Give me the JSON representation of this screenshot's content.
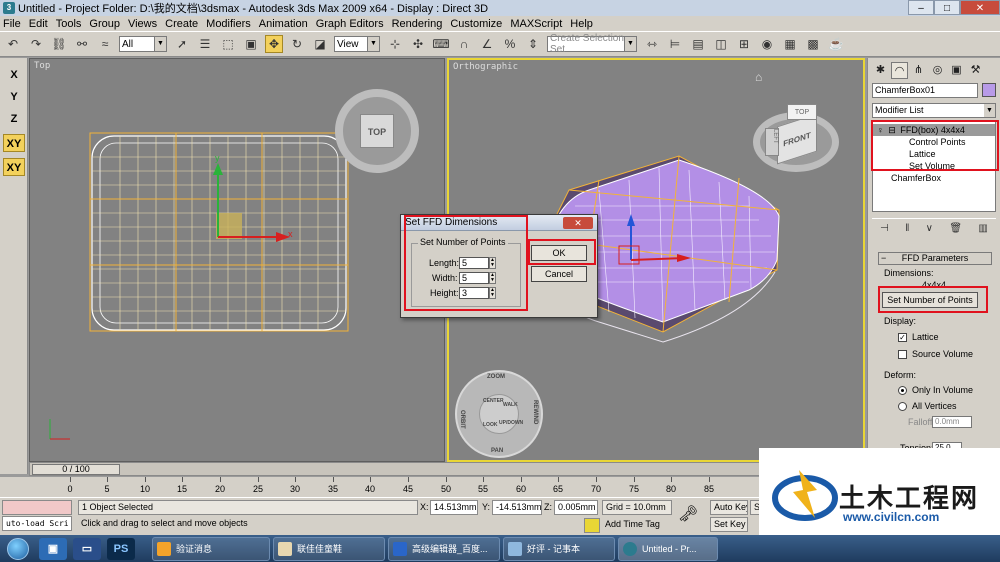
{
  "window": {
    "title": "Untitled     - Project Folder: D:\\我的文档\\3dsmax     - Autodesk 3ds Max  2009 x64     - Display : Direct 3D",
    "minimize": "–",
    "maximize": "□",
    "close": "✕"
  },
  "menu": [
    "File",
    "Edit",
    "Tools",
    "Group",
    "Views",
    "Create",
    "Modifiers",
    "Animation",
    "Graph Editors",
    "Rendering",
    "Customize",
    "MAXScript",
    "Help"
  ],
  "toolbar": {
    "filter_value": "All",
    "refcoord_value": "View",
    "selection_set_placeholder": "Create Selection Set"
  },
  "axis_constraints": [
    "X",
    "Y",
    "Z",
    "XY",
    "XY"
  ],
  "viewports": {
    "top": {
      "label": "Top",
      "viewcube_label": "TOP"
    },
    "ortho": {
      "label": "Orthographic",
      "viewcube_front": "FRONT",
      "viewcube_top": "TOP",
      "viewcube_left": "LEFT"
    },
    "gizmo": {
      "x": "x",
      "y": "y",
      "z": "z"
    },
    "steering_wheel": [
      "ZOOM",
      "ORBIT",
      "CENTER",
      "WALK",
      "REWIND",
      "LOOK",
      "UP/DOWN",
      "PAN"
    ]
  },
  "command_panel": {
    "object_name": "ChamferBox01",
    "object_color": "#b89be8",
    "modifier_list": "Modifier List",
    "stack": {
      "modifier": "FFD(box) 4x4x4",
      "subobjects": [
        "Control Points",
        "Lattice",
        "Set Volume"
      ],
      "base": "ChamferBox"
    },
    "rollout_title": "FFD Parameters",
    "dimensions_label": "Dimensions:",
    "dimensions_value": "4x4x4",
    "set_points_button": "Set Number of Points",
    "display_label": "Display:",
    "display_options": [
      {
        "label": "Lattice",
        "checked": true
      },
      {
        "label": "Source Volume",
        "checked": false
      }
    ],
    "deform_label": "Deform:",
    "deform_options": [
      {
        "label": "Only In Volume",
        "selected": true
      },
      {
        "label": "All Vertices",
        "selected": false
      }
    ],
    "falloff_label": "Falloff:",
    "falloff_value": "0.0mm",
    "tension_label": "Tension:",
    "tension_value": "25.0"
  },
  "dialog": {
    "title": "Set FFD Dimensions",
    "close": "✕",
    "group_label": "Set Number of Points",
    "fields": [
      {
        "label": "Length:",
        "value": "5"
      },
      {
        "label": "Width:",
        "value": "5"
      },
      {
        "label": "Height:",
        "value": "3"
      }
    ],
    "ok": "OK",
    "cancel": "Cancel"
  },
  "timeline": {
    "slider": "0 / 100",
    "ticks": [
      "0",
      "5",
      "10",
      "15",
      "20",
      "25",
      "30",
      "35",
      "40",
      "45",
      "50",
      "55",
      "60",
      "65",
      "70",
      "75",
      "80",
      "85"
    ]
  },
  "status": {
    "maxscript": "uto-load Scri",
    "selection": "1 Object Selected",
    "prompt": "Click and drag to select and move objects",
    "x_label": "X:",
    "x_value": "14.513mm",
    "y_label": "Y:",
    "y_value": "-14.513mm",
    "z_label": "Z:",
    "z_value": "0.005mm",
    "grid": "Grid = 10.0mm",
    "add_time_tag": "Add Time Tag",
    "auto_key": "Auto Key",
    "set_key": "Set Key",
    "selected_short": "Se"
  },
  "watermark": {
    "text": "土木工程网",
    "url": "www.civilcn.com"
  },
  "taskbar": {
    "tasks": [
      "验证消息",
      "联佳佳童鞋",
      "高级编辑器_百度...",
      "好评 - 记事本",
      "Untitled     - Pr..."
    ],
    "quick_launch": [
      "PS"
    ]
  }
}
